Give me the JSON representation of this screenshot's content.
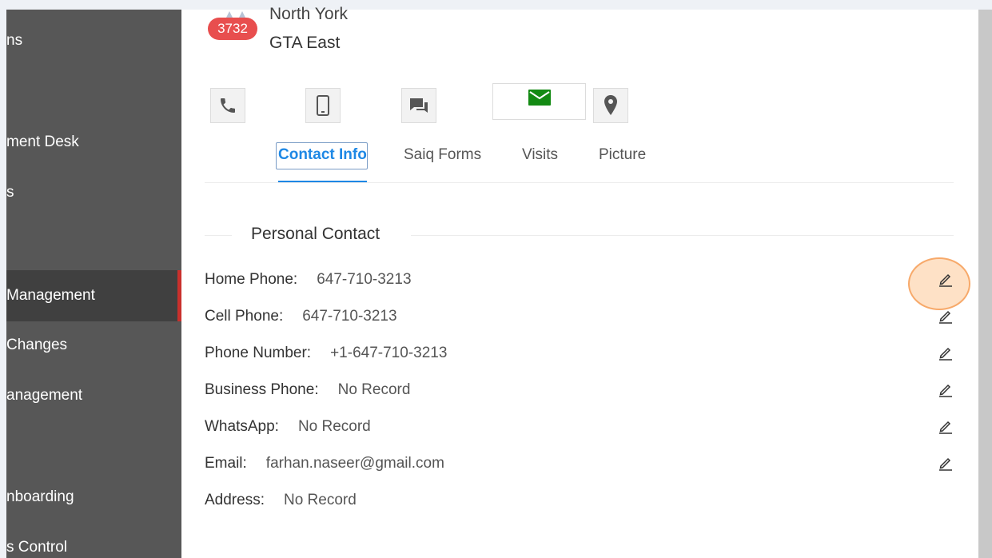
{
  "sidebar": {
    "items": [
      {
        "label": "ns",
        "active": false
      },
      {
        "label": "ment Desk",
        "active": false
      },
      {
        "label": "s",
        "active": false
      },
      {
        "label": "Management",
        "active": true
      },
      {
        "label": "Changes",
        "active": false
      },
      {
        "label": "anagement",
        "active": false
      },
      {
        "label": "nboarding",
        "active": false
      },
      {
        "label": "s Control",
        "active": false
      }
    ],
    "active_accent": "#c9302c"
  },
  "profile": {
    "badge": "3732",
    "badge_color": "#e84e4e",
    "location_line1": "North York",
    "location_line2": "GTA East"
  },
  "actions": [
    {
      "icon": "phone-icon"
    },
    {
      "icon": "mobile-icon"
    },
    {
      "icon": "chat-icon"
    },
    {
      "icon": "mail-icon",
      "color": "#138a13"
    },
    {
      "icon": "location-pin-icon"
    }
  ],
  "tabs": [
    {
      "label": "Contact Info",
      "active": true
    },
    {
      "label": "Saiq Forms",
      "active": false
    },
    {
      "label": "Visits",
      "active": false
    },
    {
      "label": "Picture",
      "active": false
    }
  ],
  "accent": "#1e88e5",
  "section": {
    "title": "Personal Contact",
    "rows": [
      {
        "label": "Home Phone:",
        "value": "647-710-3213",
        "editable": true
      },
      {
        "label": "Cell Phone:",
        "value": "647-710-3213",
        "editable": true
      },
      {
        "label": "Phone Number:",
        "value": "+1-647-710-3213",
        "editable": true
      },
      {
        "label": "Business Phone:",
        "value": "No Record",
        "editable": true
      },
      {
        "label": "WhatsApp:",
        "value": "No Record",
        "editable": true
      },
      {
        "label": "Email:",
        "value": "farhan.naseer@gmail.com",
        "editable": true
      },
      {
        "label": "Address:",
        "value": "No Record",
        "editable": false
      }
    ]
  }
}
